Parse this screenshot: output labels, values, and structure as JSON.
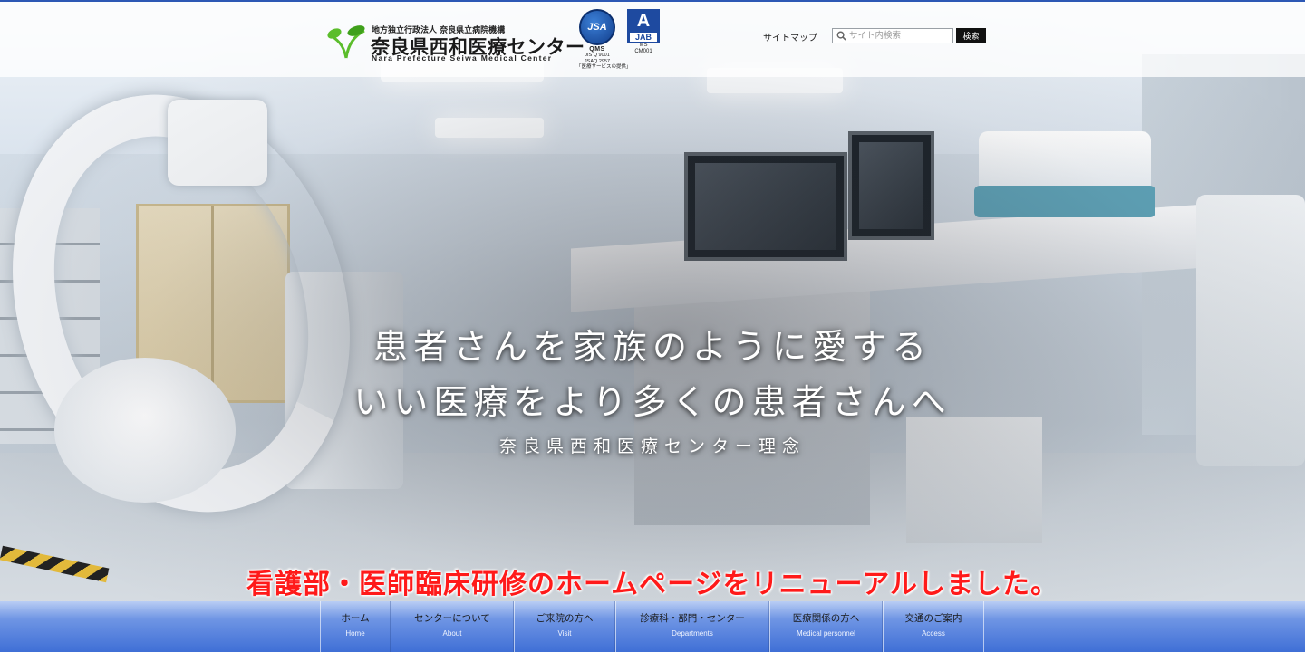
{
  "header": {
    "logo": {
      "subtitle": "地方独立行政法人 奈良県立病院機構",
      "name": "奈良県西和医療センター",
      "name_en": "Nara Prefecture Seiwa Medical Center"
    },
    "certifications": [
      {
        "badge": "JSA",
        "label": "QMS",
        "lines": [
          "JIS Q 9001",
          "JSAQ 2957",
          "「医療サービスの提供」"
        ]
      },
      {
        "badge": "JAB",
        "mark": "A",
        "lines": [
          "MS",
          "CM001"
        ]
      }
    ],
    "sitemap_label": "サイトマップ",
    "search": {
      "placeholder": "サイト内検索",
      "value": "",
      "button_label": "検索"
    }
  },
  "hero": {
    "tagline_line1": "患者さんを家族のように愛する",
    "tagline_line2": "いい医療をより多くの患者さんへ",
    "tagline_caption": "奈良県西和医療センター理念",
    "announcement": "看護部・医師臨床研修のホームページをリニューアルしました。"
  },
  "nav": {
    "items": [
      {
        "label": "ホーム",
        "sub": "Home"
      },
      {
        "label": "センターについて",
        "sub": "About"
      },
      {
        "label": "ご来院の方へ",
        "sub": "Visit"
      },
      {
        "label": "診療科・部門・センター",
        "sub": "Departments"
      },
      {
        "label": "医療関係の方へ",
        "sub": "Medical personnel"
      },
      {
        "label": "交通のご案内",
        "sub": "Access"
      }
    ]
  },
  "colors": {
    "accent_blue": "#2d58b5",
    "announcement_red": "#ff1a1a",
    "logo_green": "#5bbd2b"
  }
}
